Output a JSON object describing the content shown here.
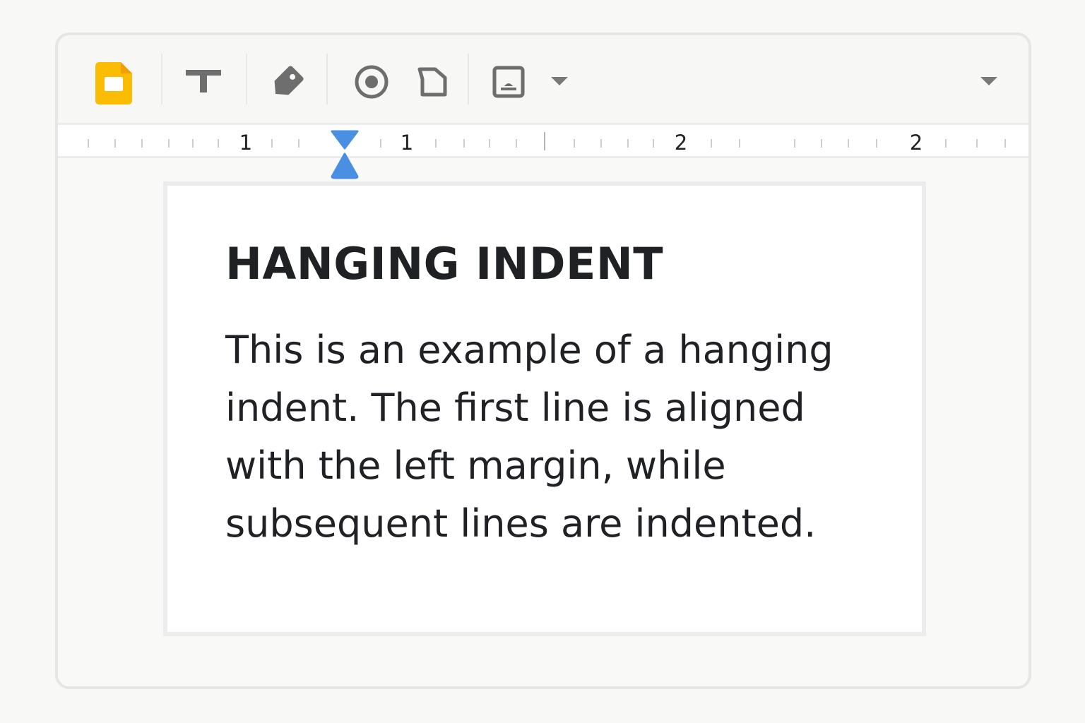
{
  "toolbar": {
    "items": [
      {
        "icon": "slides-logo-icon",
        "color": "#FBBC04"
      },
      {
        "icon": "text-box-icon"
      },
      {
        "icon": "tag-icon"
      },
      {
        "icon": "target-icon"
      },
      {
        "icon": "shape-icon"
      },
      {
        "icon": "image-icon"
      },
      {
        "icon": "chevron-down-icon"
      },
      {
        "icon": "more-chevron-down-icon"
      }
    ]
  },
  "ruler": {
    "labels": [
      "1",
      "1",
      "2",
      "2"
    ],
    "marker_color": "#4A90E2"
  },
  "document": {
    "heading": "HANGING INDENT",
    "body": "This is an example of a hanging indent. The first line is aligned with the left margin, while subsequent lines are indented."
  }
}
